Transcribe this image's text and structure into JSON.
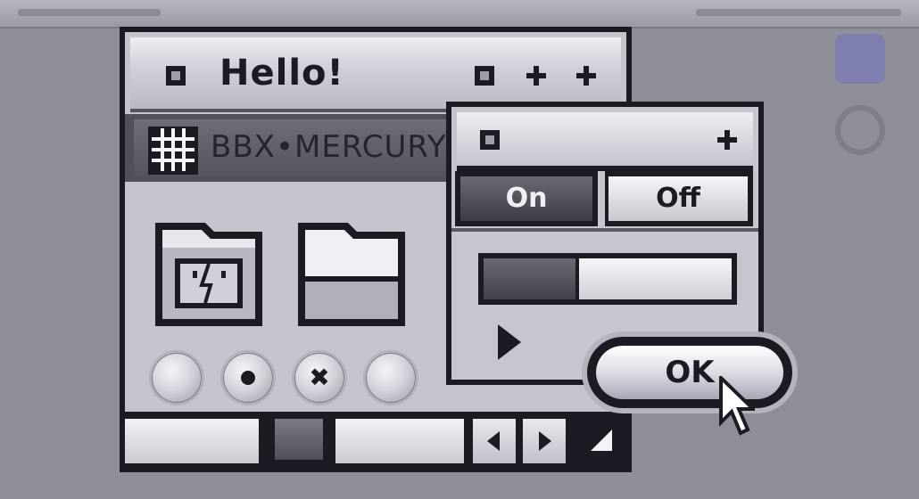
{
  "main_window": {
    "title": "Hello!",
    "toolbar_label": "BBX•MERCURY",
    "icons": [
      "finder-folder-icon",
      "folder-icon",
      "grid-icon"
    ],
    "radio_buttons": [
      "unselected",
      "selected",
      "mixed",
      "unselected"
    ]
  },
  "panel_window": {
    "toggle_on_label": "On",
    "toggle_off_label": "Off",
    "active_toggle": "On",
    "progress_fraction": 0.37,
    "disclosure": "collapsed"
  },
  "dialog": {
    "ok_label": "OK"
  },
  "colors": {
    "frame": "#1b1b24",
    "surface": "#c4c4cc",
    "desktop": "#8e8e98"
  }
}
